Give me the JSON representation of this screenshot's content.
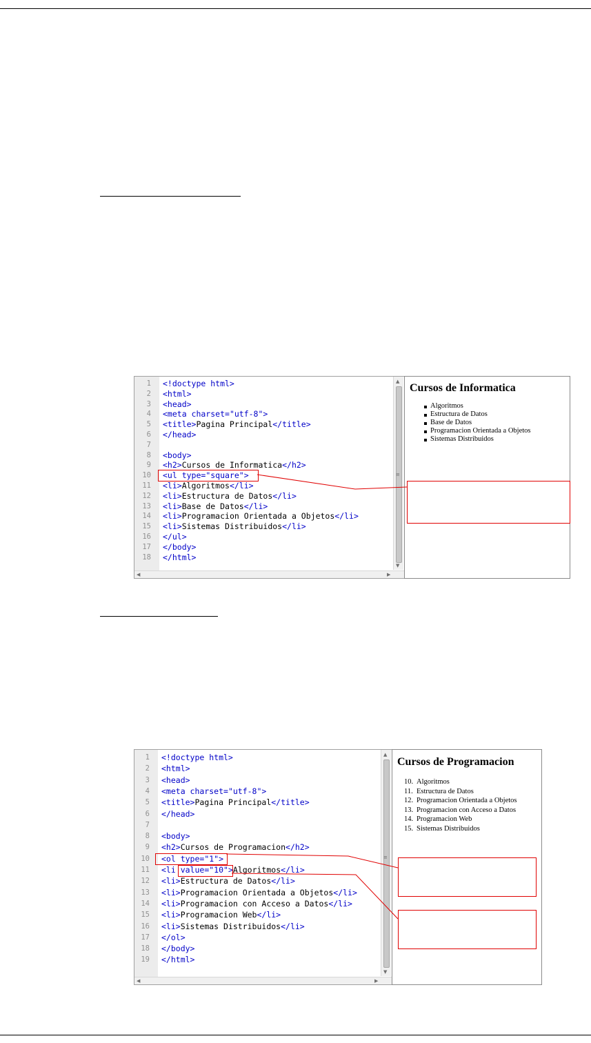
{
  "figure1": {
    "code_lines": [
      {
        "n": "1",
        "parts": [
          [
            "tag",
            "<!doctype html>"
          ]
        ]
      },
      {
        "n": "2",
        "parts": [
          [
            "tag",
            "<html>"
          ]
        ]
      },
      {
        "n": "3",
        "parts": [
          [
            "tag",
            "<head>"
          ]
        ]
      },
      {
        "n": "4",
        "parts": [
          [
            "tag",
            "<meta charset="
          ],
          [
            "str",
            "\"utf-8\""
          ],
          [
            "tag",
            ">"
          ]
        ]
      },
      {
        "n": "5",
        "parts": [
          [
            "tag",
            "<title>"
          ],
          [
            "txt",
            "Pagina Principal"
          ],
          [
            "tag",
            "</title>"
          ]
        ]
      },
      {
        "n": "6",
        "parts": [
          [
            "tag",
            "</head>"
          ]
        ]
      },
      {
        "n": "7",
        "parts": []
      },
      {
        "n": "8",
        "parts": [
          [
            "tag",
            "<body>"
          ]
        ]
      },
      {
        "n": "9",
        "parts": [
          [
            "tag",
            "<h2>"
          ],
          [
            "txt",
            "Cursos de Informatica"
          ],
          [
            "tag",
            "</h2>"
          ]
        ]
      },
      {
        "n": "10",
        "parts": [
          [
            "tag",
            "<ul type="
          ],
          [
            "str",
            "\"square\""
          ],
          [
            "tag",
            ">"
          ]
        ]
      },
      {
        "n": "11",
        "parts": [
          [
            "tag",
            "<li>"
          ],
          [
            "txt",
            "Algoritmos"
          ],
          [
            "tag",
            "</li>"
          ]
        ]
      },
      {
        "n": "12",
        "parts": [
          [
            "tag",
            "<li>"
          ],
          [
            "txt",
            "Estructura de Datos"
          ],
          [
            "tag",
            "</li>"
          ]
        ]
      },
      {
        "n": "13",
        "parts": [
          [
            "tag",
            "<li>"
          ],
          [
            "txt",
            "Base de Datos"
          ],
          [
            "tag",
            "</li>"
          ]
        ]
      },
      {
        "n": "14",
        "parts": [
          [
            "tag",
            "<li>"
          ],
          [
            "txt",
            "Programacion Orientada a Objetos"
          ],
          [
            "tag",
            "</li>"
          ]
        ]
      },
      {
        "n": "15",
        "parts": [
          [
            "tag",
            "<li>"
          ],
          [
            "txt",
            "Sistemas Distribuidos"
          ],
          [
            "tag",
            "</li>"
          ]
        ]
      },
      {
        "n": "16",
        "parts": [
          [
            "tag",
            "</ul>"
          ]
        ]
      },
      {
        "n": "17",
        "parts": [
          [
            "tag",
            "</body>"
          ]
        ]
      },
      {
        "n": "18",
        "parts": [
          [
            "tag",
            "</html>"
          ]
        ]
      }
    ],
    "preview_title": "Cursos de Informatica",
    "preview_items": [
      "Algoritmos",
      "Estructura de Datos",
      "Base de Datos",
      "Programacion Orientada a Objetos",
      "Sistemas Distribuidos"
    ]
  },
  "figure2": {
    "code_lines": [
      {
        "n": "1",
        "parts": [
          [
            "tag",
            "<!doctype html>"
          ]
        ]
      },
      {
        "n": "2",
        "parts": [
          [
            "tag",
            "<html>"
          ]
        ]
      },
      {
        "n": "3",
        "parts": [
          [
            "tag",
            "<head>"
          ]
        ]
      },
      {
        "n": "4",
        "parts": [
          [
            "tag",
            "<meta charset="
          ],
          [
            "str",
            "\"utf-8\""
          ],
          [
            "tag",
            ">"
          ]
        ]
      },
      {
        "n": "5",
        "parts": [
          [
            "tag",
            "<title>"
          ],
          [
            "txt",
            "Pagina Principal"
          ],
          [
            "tag",
            "</title>"
          ]
        ]
      },
      {
        "n": "6",
        "parts": [
          [
            "tag",
            "</head>"
          ]
        ]
      },
      {
        "n": "7",
        "parts": []
      },
      {
        "n": "8",
        "parts": [
          [
            "tag",
            "<body>"
          ]
        ]
      },
      {
        "n": "9",
        "parts": [
          [
            "tag",
            "<h2>"
          ],
          [
            "txt",
            "Cursos de Programacion"
          ],
          [
            "tag",
            "</h2>"
          ]
        ]
      },
      {
        "n": "10",
        "parts": [
          [
            "tag",
            "<ol type="
          ],
          [
            "str",
            "\"1\""
          ],
          [
            "tag",
            ">"
          ]
        ]
      },
      {
        "n": "11",
        "parts": [
          [
            "tag",
            "<li "
          ],
          [
            "tag",
            "value="
          ],
          [
            "str",
            "\"10\""
          ],
          [
            "tag",
            ">"
          ],
          [
            "txt",
            "Algoritmos"
          ],
          [
            "tag",
            "</li>"
          ]
        ]
      },
      {
        "n": "12",
        "parts": [
          [
            "tag",
            "<li>"
          ],
          [
            "txt",
            "Estructura de Datos"
          ],
          [
            "tag",
            "</li>"
          ]
        ]
      },
      {
        "n": "13",
        "parts": [
          [
            "tag",
            "<li>"
          ],
          [
            "txt",
            "Programacion Orientada a Objetos"
          ],
          [
            "tag",
            "</li>"
          ]
        ]
      },
      {
        "n": "14",
        "parts": [
          [
            "tag",
            "<li>"
          ],
          [
            "txt",
            "Programacion con Acceso a Datos"
          ],
          [
            "tag",
            "</li>"
          ]
        ]
      },
      {
        "n": "15",
        "parts": [
          [
            "tag",
            "<li>"
          ],
          [
            "txt",
            "Programacion Web"
          ],
          [
            "tag",
            "</li>"
          ]
        ]
      },
      {
        "n": "16",
        "parts": [
          [
            "tag",
            "<li>"
          ],
          [
            "txt",
            "Sistemas Distribuidos"
          ],
          [
            "tag",
            "</li>"
          ]
        ]
      },
      {
        "n": "17",
        "parts": [
          [
            "tag",
            "</ol>"
          ]
        ]
      },
      {
        "n": "18",
        "parts": [
          [
            "tag",
            "</body>"
          ]
        ]
      },
      {
        "n": "19",
        "parts": [
          [
            "tag",
            "</html>"
          ]
        ]
      }
    ],
    "preview_title": "Cursos de Programacion",
    "preview_numbers": [
      "10.",
      "11.",
      "12.",
      "13.",
      "14.",
      "15."
    ],
    "preview_items": [
      "Algoritmos",
      "Estructura de Datos",
      "Programacion Orientada a Objetos",
      "Programacion con Acceso a Datos",
      "Programacion Web",
      "Sistemas Distribuidos"
    ]
  },
  "colors": {
    "tag": "#0000c8",
    "text": "#000000",
    "annotation": "#e00000",
    "gutter": "#ececec"
  },
  "icons": {
    "scroll_up": "triangle-up-icon",
    "scroll_down": "triangle-down-icon",
    "scroll_left": "triangle-left-icon",
    "scroll_right": "triangle-right-icon",
    "grip": "grip-icon"
  }
}
